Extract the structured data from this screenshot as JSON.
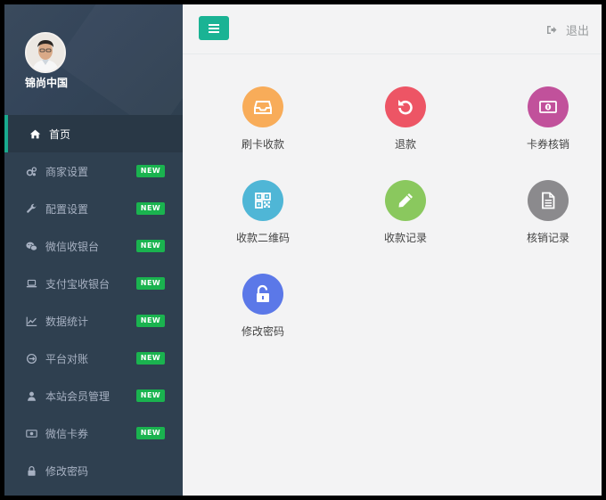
{
  "profile": {
    "name": "锦尚中国"
  },
  "menu": [
    {
      "label": "首页",
      "icon": "home-icon",
      "active": true,
      "badge": ""
    },
    {
      "label": "商家设置",
      "icon": "gears-icon",
      "badge": "NEW"
    },
    {
      "label": "配置设置",
      "icon": "wrench-icon",
      "badge": "NEW"
    },
    {
      "label": "微信收银台",
      "icon": "wechat-icon",
      "badge": "NEW"
    },
    {
      "label": "支付宝收银台",
      "icon": "laptop-icon",
      "badge": "NEW"
    },
    {
      "label": "数据统计",
      "icon": "line-chart-icon",
      "badge": "NEW"
    },
    {
      "label": "平台对账",
      "icon": "reconcile-icon",
      "badge": "NEW"
    },
    {
      "label": "本站会员管理",
      "icon": "user-icon",
      "badge": "NEW"
    },
    {
      "label": "微信卡券",
      "icon": "money-icon",
      "badge": "NEW"
    },
    {
      "label": "修改密码",
      "icon": "lock-icon",
      "badge": ""
    }
  ],
  "topbar": {
    "logout_label": "退出"
  },
  "tiles": [
    {
      "label": "刷卡收款",
      "icon": "inbox-icon",
      "color": "#f8ac59"
    },
    {
      "label": "退款",
      "icon": "undo-icon",
      "color": "#ed5565"
    },
    {
      "label": "卡券核销",
      "icon": "money-icon",
      "color": "#c1519b"
    },
    {
      "label": "收款二维码",
      "icon": "qrcode-icon",
      "color": "#4fb6d6"
    },
    {
      "label": "收款记录",
      "icon": "pencil-icon",
      "color": "#8ac85e"
    },
    {
      "label": "核销记录",
      "icon": "file-icon",
      "color": "#8b8a8d"
    },
    {
      "label": "修改密码",
      "icon": "unlock-icon",
      "color": "#5b78e8"
    }
  ]
}
